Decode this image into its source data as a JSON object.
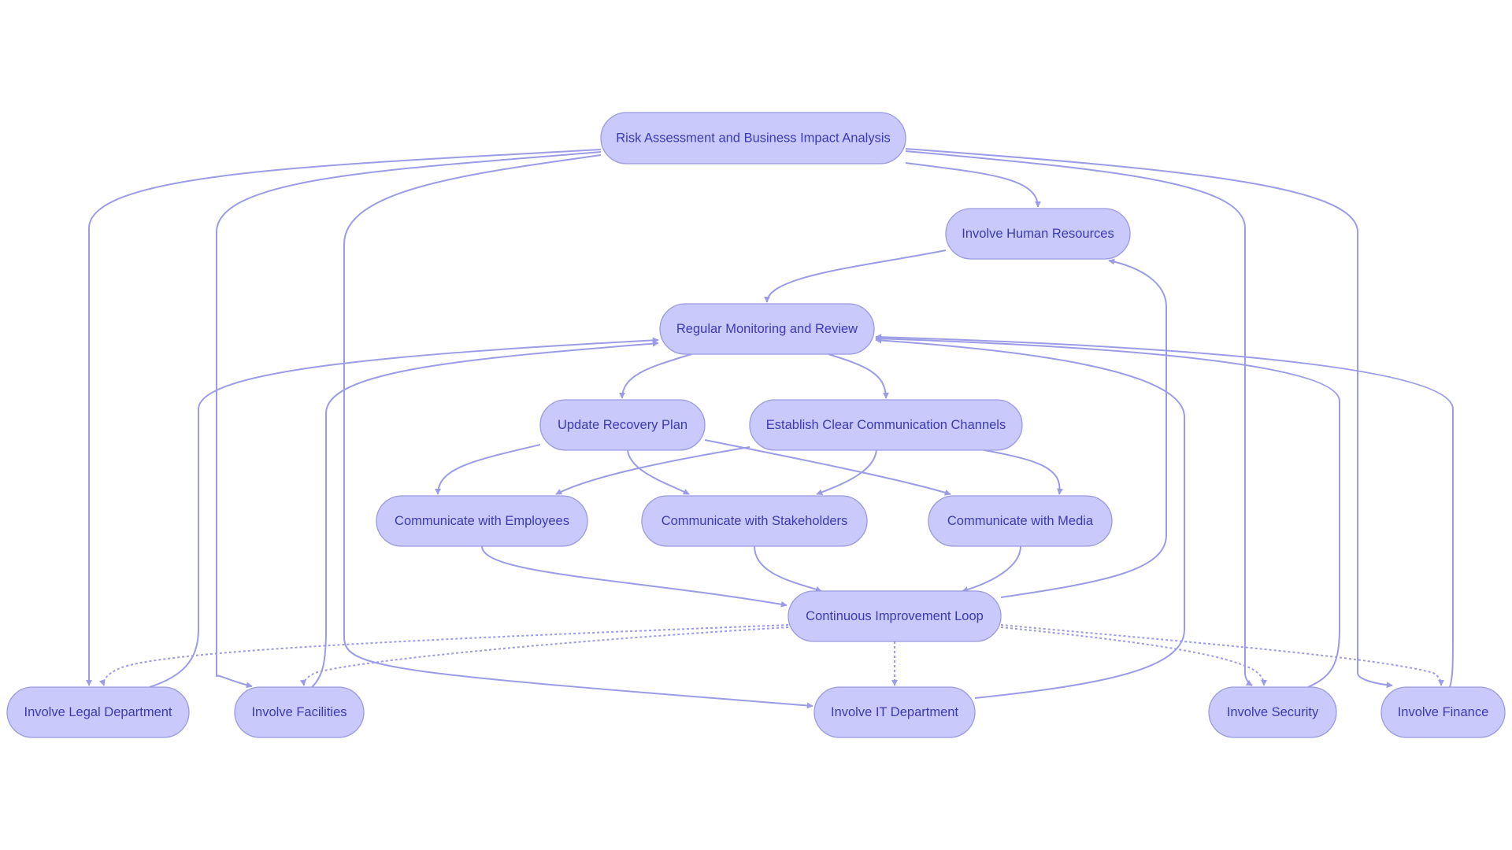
{
  "diagram": {
    "type": "flowchart",
    "colors": {
      "node_fill": "#c9c9fb",
      "node_stroke": "#9b9bdf",
      "text": "#3b3bb0",
      "edge": "#9b9be6",
      "background": "#ffffff"
    },
    "nodes": [
      {
        "id": "risk",
        "label": "Risk Assessment and Business Impact Analysis"
      },
      {
        "id": "hr",
        "label": "Involve Human Resources"
      },
      {
        "id": "monitor",
        "label": "Regular Monitoring and Review"
      },
      {
        "id": "update",
        "label": "Update Recovery Plan"
      },
      {
        "id": "establish",
        "label": "Establish Clear Communication Channels"
      },
      {
        "id": "employees",
        "label": "Communicate with Employees"
      },
      {
        "id": "stakeholders",
        "label": "Communicate with Stakeholders"
      },
      {
        "id": "media",
        "label": "Communicate with Media"
      },
      {
        "id": "cil",
        "label": "Continuous Improvement Loop"
      },
      {
        "id": "legal",
        "label": "Involve Legal Department"
      },
      {
        "id": "facilities",
        "label": "Involve Facilities"
      },
      {
        "id": "it",
        "label": "Involve IT Department"
      },
      {
        "id": "security",
        "label": "Involve Security"
      },
      {
        "id": "finance",
        "label": "Involve Finance"
      }
    ],
    "edges": [
      {
        "from": "risk",
        "to": "legal",
        "style": "solid"
      },
      {
        "from": "risk",
        "to": "facilities",
        "style": "solid"
      },
      {
        "from": "risk",
        "to": "it",
        "style": "solid"
      },
      {
        "from": "risk",
        "to": "hr",
        "style": "solid"
      },
      {
        "from": "risk",
        "to": "security",
        "style": "solid"
      },
      {
        "from": "risk",
        "to": "finance",
        "style": "solid"
      },
      {
        "from": "hr",
        "to": "monitor",
        "style": "solid"
      },
      {
        "from": "legal",
        "to": "monitor",
        "style": "solid"
      },
      {
        "from": "facilities",
        "to": "monitor",
        "style": "solid"
      },
      {
        "from": "it",
        "to": "monitor",
        "style": "solid"
      },
      {
        "from": "security",
        "to": "monitor",
        "style": "solid"
      },
      {
        "from": "finance",
        "to": "monitor",
        "style": "solid"
      },
      {
        "from": "monitor",
        "to": "update",
        "style": "solid"
      },
      {
        "from": "monitor",
        "to": "establish",
        "style": "solid"
      },
      {
        "from": "update",
        "to": "employees",
        "style": "solid"
      },
      {
        "from": "update",
        "to": "stakeholders",
        "style": "solid"
      },
      {
        "from": "update",
        "to": "media",
        "style": "solid"
      },
      {
        "from": "establish",
        "to": "employees",
        "style": "solid"
      },
      {
        "from": "establish",
        "to": "stakeholders",
        "style": "solid"
      },
      {
        "from": "establish",
        "to": "media",
        "style": "solid"
      },
      {
        "from": "employees",
        "to": "cil",
        "style": "solid"
      },
      {
        "from": "stakeholders",
        "to": "cil",
        "style": "solid"
      },
      {
        "from": "media",
        "to": "cil",
        "style": "solid"
      },
      {
        "from": "cil",
        "to": "hr",
        "style": "solid"
      },
      {
        "from": "cil",
        "to": "legal",
        "style": "dotted"
      },
      {
        "from": "cil",
        "to": "facilities",
        "style": "dotted"
      },
      {
        "from": "cil",
        "to": "it",
        "style": "dotted"
      },
      {
        "from": "cil",
        "to": "security",
        "style": "dotted"
      },
      {
        "from": "cil",
        "to": "finance",
        "style": "dotted"
      }
    ]
  }
}
